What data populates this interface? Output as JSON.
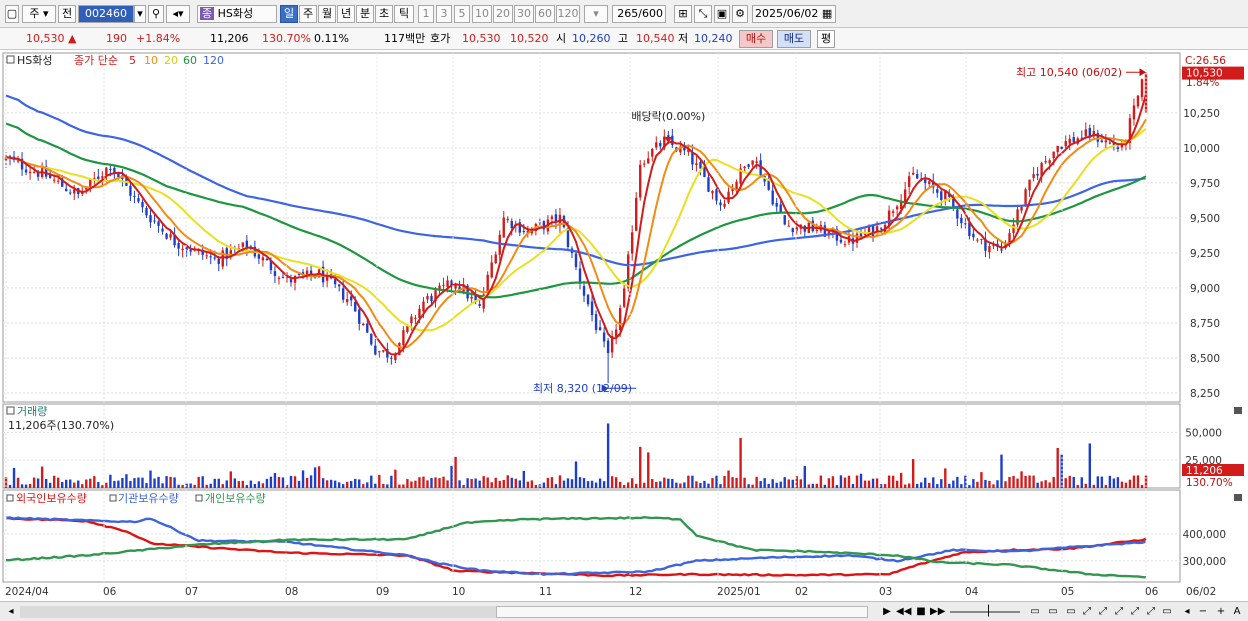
{
  "toolbar": {
    "period_selected": "주",
    "prev_label": "전",
    "stock_code": "002460",
    "stock_name": "HS화성",
    "periods": [
      "일",
      "주",
      "월",
      "년",
      "분",
      "초",
      "틱"
    ],
    "minutes": [
      "1",
      "3",
      "5",
      "10",
      "20",
      "30",
      "60",
      "120"
    ],
    "count_display": "265",
    "count_total": "/600",
    "date": "2025/06/02"
  },
  "quote": {
    "price": "10,530",
    "change_arrow": "▲",
    "change": "190",
    "change_pct": "+1.84%",
    "volume": "11,206",
    "volume_ratio": "130.70%",
    "turnover": "0.11%",
    "amount": "117백만",
    "bid_label": "호가",
    "ask_price": "10,530",
    "bid_price": "10,520",
    "open_label": "시",
    "open": "10,260",
    "high_label": "고",
    "high": "10,540",
    "low_label": "저",
    "low": "10,240",
    "buy_label": "매수",
    "sell_label": "매도",
    "flat_label": "평"
  },
  "colors": {
    "up": "#d21c1c",
    "down": "#1d3fc8",
    "ma5": "#d21c1c",
    "ma10": "#f08c14",
    "ma20": "#e8e020",
    "ma60": "#1e9640",
    "ma120": "#3c64e6",
    "foreign": "#dc1414",
    "institution": "#3c64dc",
    "individual": "#329650"
  },
  "chart_data": [
    {
      "type": "candlestick",
      "legend": {
        "name": "HS화성",
        "ma_title": "종가 단순",
        "ma_periods": [
          "5",
          "10",
          "20",
          "60",
          "120"
        ]
      },
      "y_ticks": [
        "10,250",
        "10,000",
        "9,750",
        "9,500",
        "9,250",
        "9,000",
        "8,750",
        "8,500",
        "8,250"
      ],
      "y_range": [
        8200,
        10620
      ],
      "x_ticks": [
        "2024/04",
        "06",
        "07",
        "08",
        "09",
        "10",
        "11",
        "12",
        "2025/01",
        "02",
        "03",
        "04",
        "05",
        "06",
        "06/02"
      ],
      "last_price_label": "10,530",
      "last_pct_label": "1.84%",
      "corner_label": "C:26.56",
      "annotations": {
        "high": "최고 10,540 (06/02)",
        "low": "최저 8,320 (12/09)",
        "dividend": "배당락(0.00%)"
      },
      "anchors": [
        [
          0,
          9920
        ],
        [
          10,
          9800
        ],
        [
          18,
          9660
        ],
        [
          26,
          9880
        ],
        [
          34,
          9560
        ],
        [
          42,
          9330
        ],
        [
          52,
          9200
        ],
        [
          60,
          9300
        ],
        [
          70,
          9050
        ],
        [
          78,
          9100
        ],
        [
          86,
          8900
        ],
        [
          92,
          8560
        ],
        [
          96,
          8520
        ],
        [
          104,
          8900
        ],
        [
          112,
          9050
        ],
        [
          118,
          8850
        ],
        [
          124,
          9500
        ],
        [
          130,
          9400
        ],
        [
          138,
          9500
        ],
        [
          144,
          8960
        ],
        [
          150,
          8500
        ],
        [
          154,
          8960
        ],
        [
          158,
          9900
        ],
        [
          164,
          10050
        ],
        [
          170,
          9950
        ],
        [
          178,
          9600
        ],
        [
          186,
          9950
        ],
        [
          194,
          9450
        ],
        [
          202,
          9420
        ],
        [
          210,
          9330
        ],
        [
          218,
          9440
        ],
        [
          226,
          9800
        ],
        [
          234,
          9650
        ],
        [
          242,
          9330
        ],
        [
          248,
          9270
        ],
        [
          256,
          9800
        ],
        [
          262,
          10020
        ],
        [
          270,
          10100
        ],
        [
          278,
          9990
        ],
        [
          284,
          10540
        ]
      ],
      "n": 285
    },
    {
      "type": "bar",
      "title": "거래량",
      "value_label": "11,206주(130.70%)",
      "y_ticks": [
        "50,000",
        "25,000"
      ],
      "last_label": "11,206",
      "last_pct": "130.70%"
    },
    {
      "type": "line",
      "series": [
        {
          "name": "외국인보유수량",
          "key": "foreign",
          "anchors": [
            [
              0,
              458000
            ],
            [
              20,
              448000
            ],
            [
              30,
              410000
            ],
            [
              36,
              365000
            ],
            [
              50,
              350000
            ],
            [
              70,
              330000
            ],
            [
              100,
              320000
            ],
            [
              112,
              262000
            ],
            [
              130,
              255000
            ],
            [
              150,
              245000
            ],
            [
              170,
              250000
            ],
            [
              196,
              247000
            ],
            [
              220,
              250000
            ],
            [
              226,
              280000
            ],
            [
              238,
              330000
            ],
            [
              250,
              340000
            ],
            [
              265,
              345000
            ],
            [
              284,
              380000
            ]
          ]
        },
        {
          "name": "기관보유수량",
          "key": "institution",
          "anchors": [
            [
              0,
              460000
            ],
            [
              24,
              448000
            ],
            [
              32,
              445000
            ],
            [
              36,
              458000
            ],
            [
              48,
              375000
            ],
            [
              70,
              370000
            ],
            [
              100,
              320000
            ],
            [
              108,
              290000
            ],
            [
              118,
              265000
            ],
            [
              134,
              250000
            ],
            [
              160,
              260000
            ],
            [
              172,
              300000
            ],
            [
              190,
              312000
            ],
            [
              210,
              320000
            ],
            [
              222,
              300000
            ],
            [
              236,
              340000
            ],
            [
              252,
              335000
            ],
            [
              265,
              350000
            ],
            [
              284,
              370000
            ]
          ]
        },
        {
          "name": "개인보유수량",
          "key": "individual",
          "anchors": [
            [
              0,
              302000
            ],
            [
              20,
              320000
            ],
            [
              48,
              360000
            ],
            [
              70,
              378000
            ],
            [
              100,
              380000
            ],
            [
              114,
              440000
            ],
            [
              130,
              455000
            ],
            [
              160,
              460000
            ],
            [
              168,
              455000
            ],
            [
              172,
              395000
            ],
            [
              186,
              340000
            ],
            [
              200,
              335000
            ],
            [
              222,
              320000
            ],
            [
              232,
              295000
            ],
            [
              250,
              285000
            ],
            [
              270,
              250000
            ],
            [
              284,
              240000
            ]
          ]
        }
      ],
      "y_ticks": [
        "400,000",
        "300,000"
      ],
      "y_range": [
        225000,
        500000
      ]
    }
  ]
}
